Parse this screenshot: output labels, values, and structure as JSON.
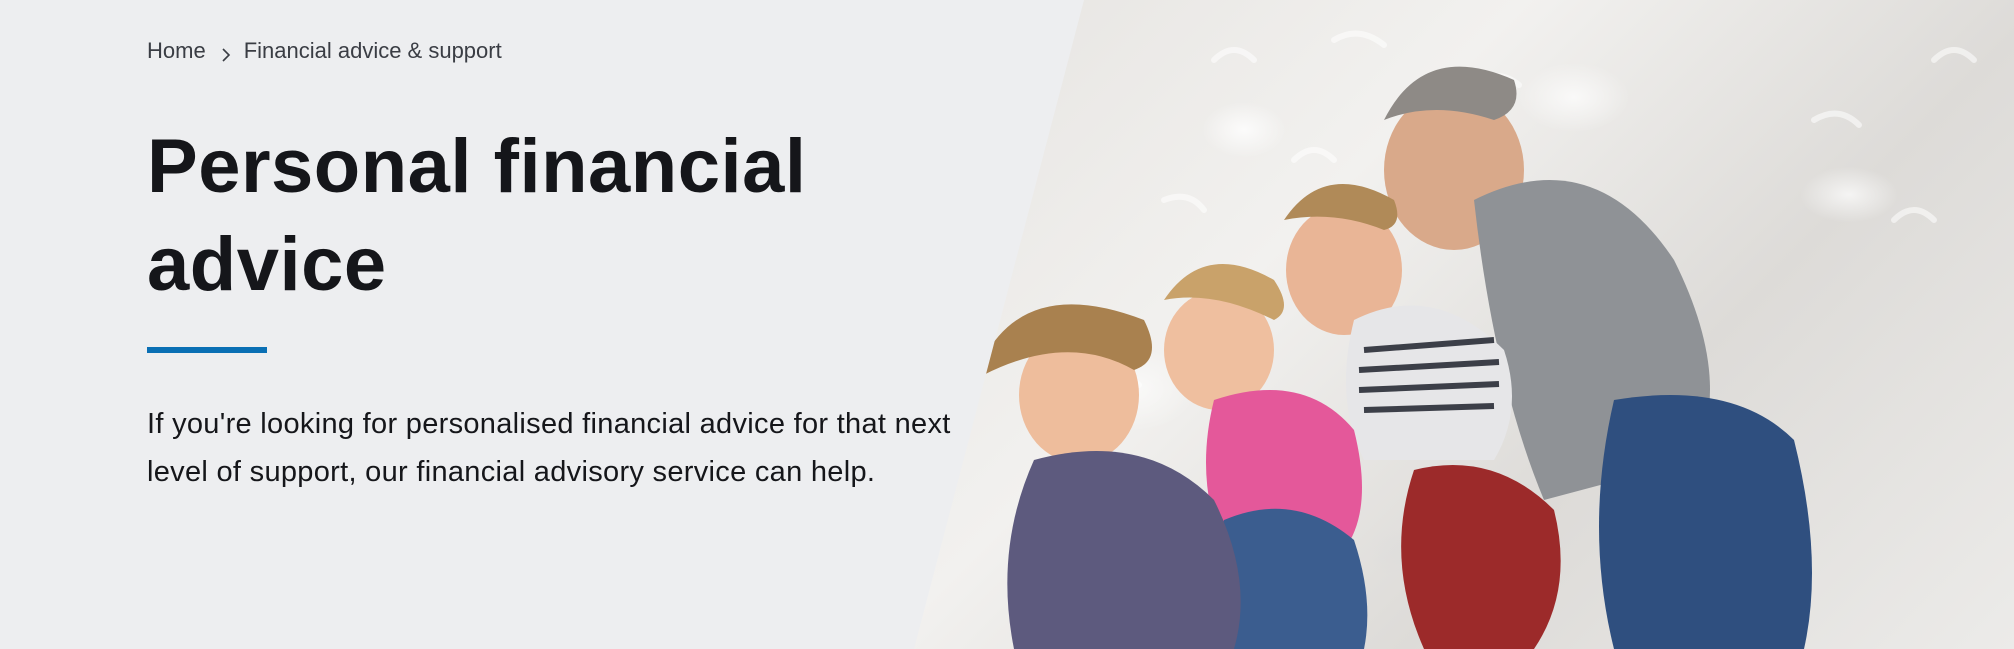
{
  "breadcrumb": {
    "home_label": "Home",
    "separator_icon": "chevron-right-icon",
    "current_label": "Financial advice & support"
  },
  "hero": {
    "title": "Personal financial advice",
    "intro": "If you're looking for personalised financial advice for that next level of support, our financial advisory service can help.",
    "accent_color": "#0a6fb4",
    "background_color": "#edeef0"
  }
}
